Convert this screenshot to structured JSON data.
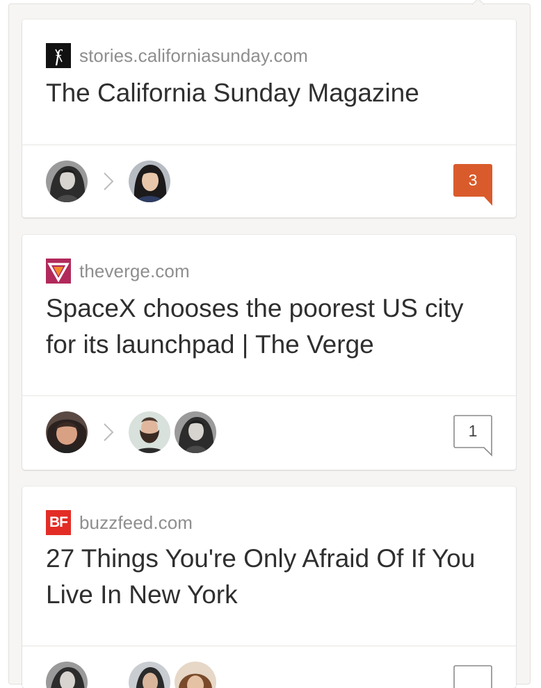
{
  "feed": [
    {
      "domain": "stories.californiasunday.com",
      "favicon": "california-sunday-logo",
      "title": "The California Sunday Magazine",
      "comment_count": "3",
      "comment_style": "filled",
      "accent": "#d95b2b"
    },
    {
      "domain": "theverge.com",
      "favicon": "the-verge-logo",
      "title": "SpaceX chooses the poorest US city for its launchpad | The Verge",
      "comment_count": "1",
      "comment_style": "outline",
      "accent": "#b12a5b"
    },
    {
      "domain": "buzzfeed.com",
      "favicon": "buzzfeed-logo",
      "favicon_text": "BF",
      "title": "27 Things You're Only Afraid Of If You Live In New York",
      "accent": "#e32c26"
    }
  ]
}
